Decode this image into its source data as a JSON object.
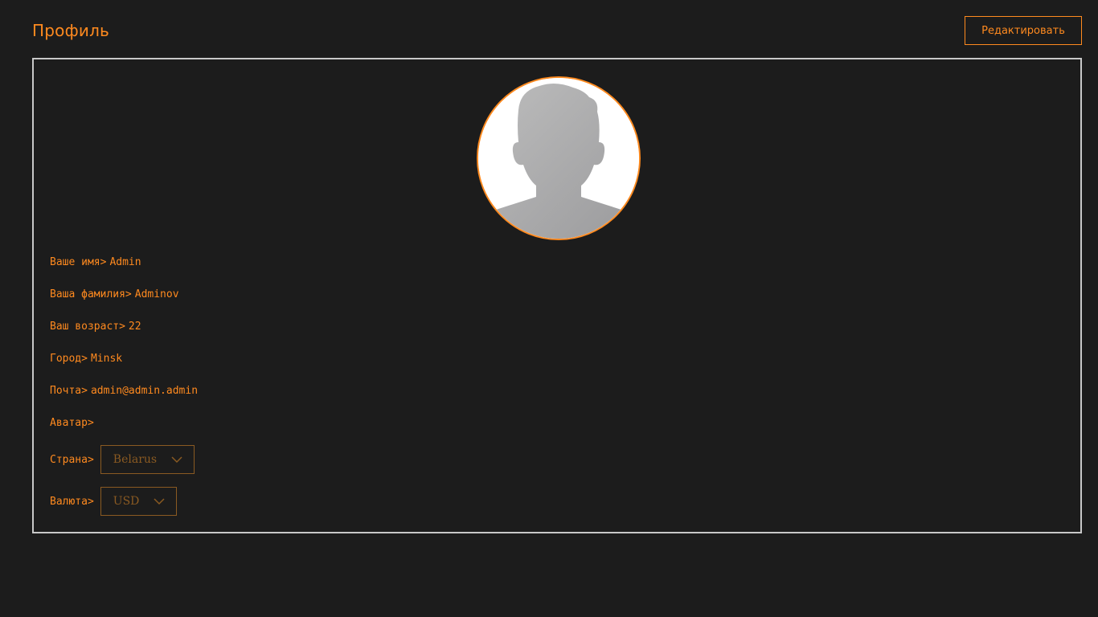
{
  "header": {
    "title": "Профиль",
    "edit_label": "Редактировать"
  },
  "profile": {
    "avatar_icon": "user-silhouette-icon",
    "fields": [
      {
        "label": "Ваше имя>",
        "value": "Admin"
      },
      {
        "label": "Ваша фамилия>",
        "value": "Adminov"
      },
      {
        "label": "Ваш возраст>",
        "value": "22"
      },
      {
        "label": "Город>",
        "value": "Minsk"
      },
      {
        "label": "Почта>",
        "value": "admin@admin.admin"
      },
      {
        "label": "Аватар>",
        "value": ""
      }
    ],
    "country": {
      "label": "Страна>",
      "selected": "Belarus"
    },
    "currency": {
      "label": "Валюта>",
      "selected": "USD"
    }
  },
  "colors": {
    "background": "#1c1c1c",
    "accent": "#ff8a1f",
    "card_border": "#c8c8c8",
    "select_muted": "#8a5a22"
  }
}
